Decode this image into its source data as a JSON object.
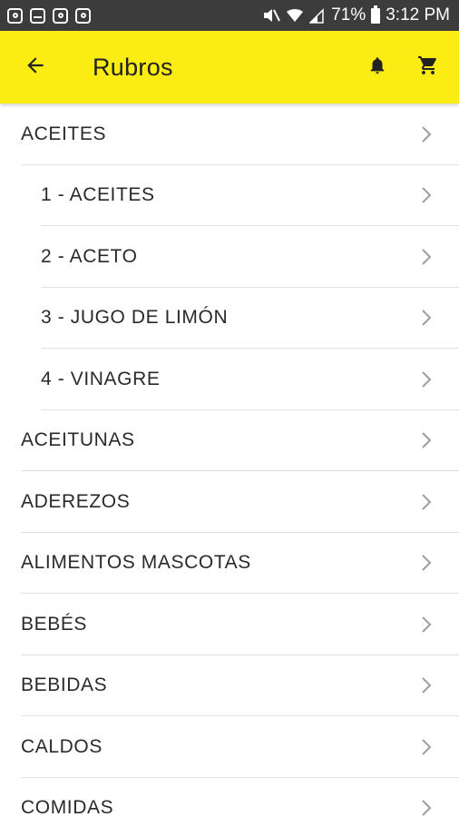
{
  "status_bar": {
    "battery_percent": "71%",
    "time": "3:12 PM",
    "left_icons": [
      "instagram-icon",
      "gallery-icon",
      "app-icon",
      "app-icon"
    ],
    "right_icons": [
      "mute-icon",
      "wifi-icon",
      "signal-icon",
      "battery-icon"
    ]
  },
  "app_bar": {
    "title": "Rubros",
    "back_icon": "back-arrow-icon",
    "actions": [
      "bell-icon",
      "cart-icon"
    ],
    "background": "#fbec13"
  },
  "rows": [
    {
      "label": "ACEITES",
      "level": "top"
    },
    {
      "label": "1 - ACEITES",
      "level": "sub"
    },
    {
      "label": "2 - ACETO",
      "level": "sub"
    },
    {
      "label": "3 - JUGO DE LIMÓN",
      "level": "sub"
    },
    {
      "label": "4 - VINAGRE",
      "level": "sub"
    },
    {
      "label": "ACEITUNAS",
      "level": "top"
    },
    {
      "label": "ADEREZOS",
      "level": "top"
    },
    {
      "label": "ALIMENTOS MASCOTAS",
      "level": "top"
    },
    {
      "label": "BEBÉS",
      "level": "top"
    },
    {
      "label": "BEBIDAS",
      "level": "top"
    },
    {
      "label": "CALDOS",
      "level": "top"
    },
    {
      "label": "COMIDAS",
      "level": "top"
    }
  ]
}
